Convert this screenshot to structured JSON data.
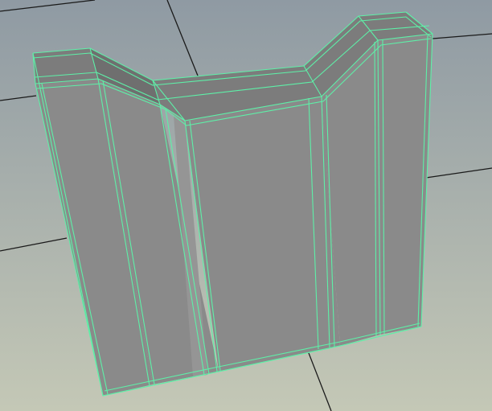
{
  "viewport": {
    "background_top": "#8f9aa3",
    "background_bottom": "#c4c8b6",
    "grid_color": "#1a1a1a",
    "wire_color": "#5ef0a8",
    "face_color": "#8a8a8a",
    "face_light": "#959595",
    "face_dark": "#6f6f6f",
    "top_face_color": "#7c7c7c"
  }
}
